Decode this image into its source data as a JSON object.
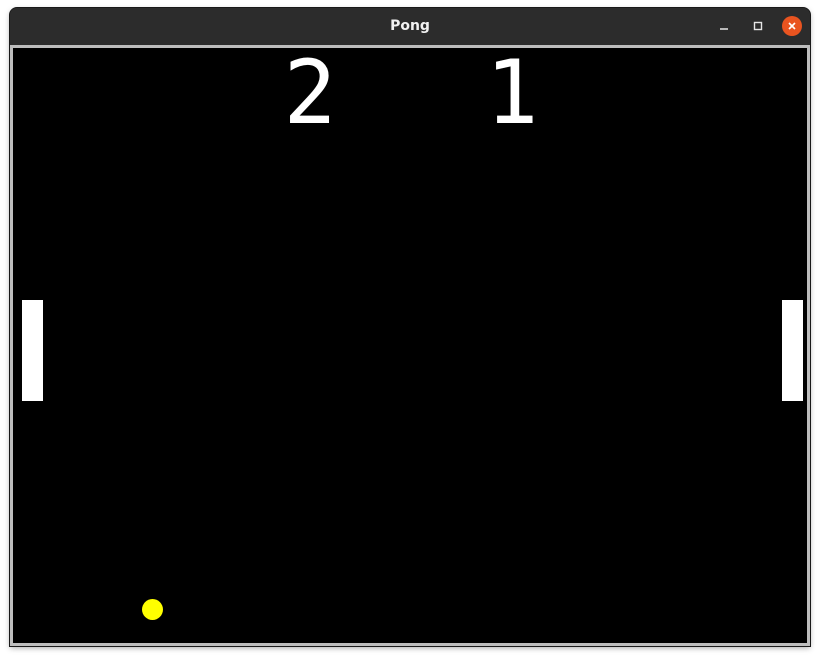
{
  "window": {
    "title": "Pong",
    "controls": {
      "minimize_icon": "minimize-icon",
      "maximize_icon": "maximize-icon",
      "close_icon": "close-icon",
      "close_color": "#e95420"
    }
  },
  "game": {
    "score_left": "2",
    "score_right": "1",
    "colors": {
      "background": "#000000",
      "paddle": "#ffffff",
      "ball": "#ffff00",
      "score": "#ffffff"
    }
  }
}
